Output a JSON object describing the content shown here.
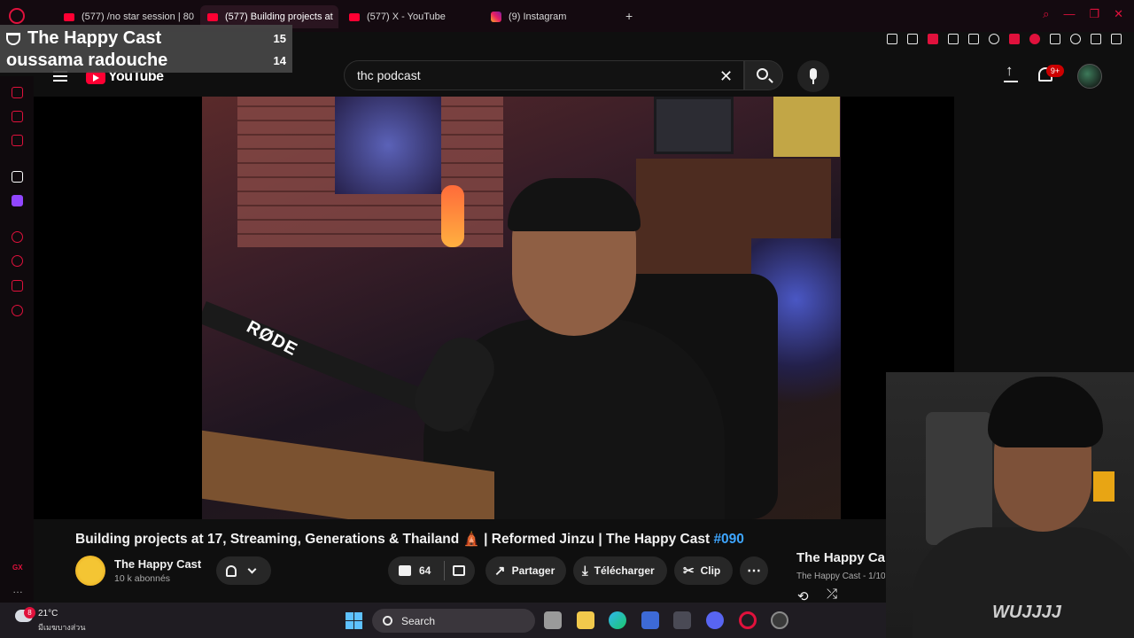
{
  "browser": {
    "tabs": [
      {
        "label": "(577) /no star session | 80",
        "active": false
      },
      {
        "label": "(577) Building projects at",
        "active": true
      },
      {
        "label": "(577) X - YouTube",
        "active": false
      },
      {
        "label": "(9) Instagram",
        "active": false
      }
    ],
    "new_tab": "+"
  },
  "leaderboard": {
    "rows": [
      {
        "name": "The Happy Cast",
        "score": "15"
      },
      {
        "name": "oussama radouche",
        "score": "14"
      }
    ]
  },
  "youtube": {
    "logo_text": "YouTube",
    "search_value": "thc podcast",
    "notifications": "9+",
    "video_overlay_brand": "RØDE",
    "webcam_shirt_text": "WUJJJJ",
    "title_main": "Building projects at 17, Streaming, Generations & Thailand 🛕 | Reformed Jinzu | The Happy Cast ",
    "title_tag": "#090",
    "channel": {
      "name": "The Happy Cast",
      "subs": "10 k abonnés"
    },
    "likes": "64",
    "share_label": "Partager",
    "download_label": "Télécharger",
    "clip_label": "Clip",
    "more_label": "⋯",
    "playlist": {
      "title": "The Happy Cast",
      "subtitle": "The Happy Cast - 1/10"
    }
  },
  "taskbar": {
    "weather_temp": "21°C",
    "weather_desc": "มีเมฆบางส่วน",
    "weather_badge": "8",
    "search_label": "Search"
  },
  "colors": {
    "accent": "#e0113c",
    "yt_red": "#ff0033",
    "link_blue": "#3ea6ff"
  }
}
